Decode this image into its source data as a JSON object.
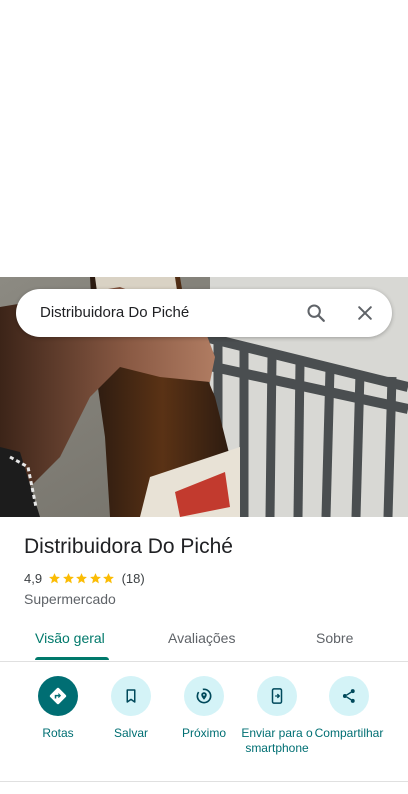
{
  "search": {
    "query": "Distribuidora Do Piché"
  },
  "place": {
    "title": "Distribuidora Do Piché",
    "rating_text": "4,9",
    "rating_value": 4.9,
    "star_count": 5,
    "reviews_text": "(18)",
    "category": "Supermercado"
  },
  "tabs": [
    {
      "label": "Visão geral",
      "active": true
    },
    {
      "label": "Avaliações",
      "active": false
    },
    {
      "label": "Sobre",
      "active": false
    }
  ],
  "actions": [
    {
      "label": "Rotas",
      "icon": "directions-icon"
    },
    {
      "label": "Salvar",
      "icon": "bookmark-icon"
    },
    {
      "label": "Próximo",
      "icon": "nearby-icon"
    },
    {
      "label": "Enviar para o smartphone",
      "icon": "send-to-phone-icon"
    },
    {
      "label": "Compartilhar",
      "icon": "share-icon"
    }
  ],
  "colors": {
    "accent": "#00796b",
    "action_primary": "#006e73",
    "action_secondary_bg": "#d4f3f7",
    "star": "#fbbc04"
  }
}
